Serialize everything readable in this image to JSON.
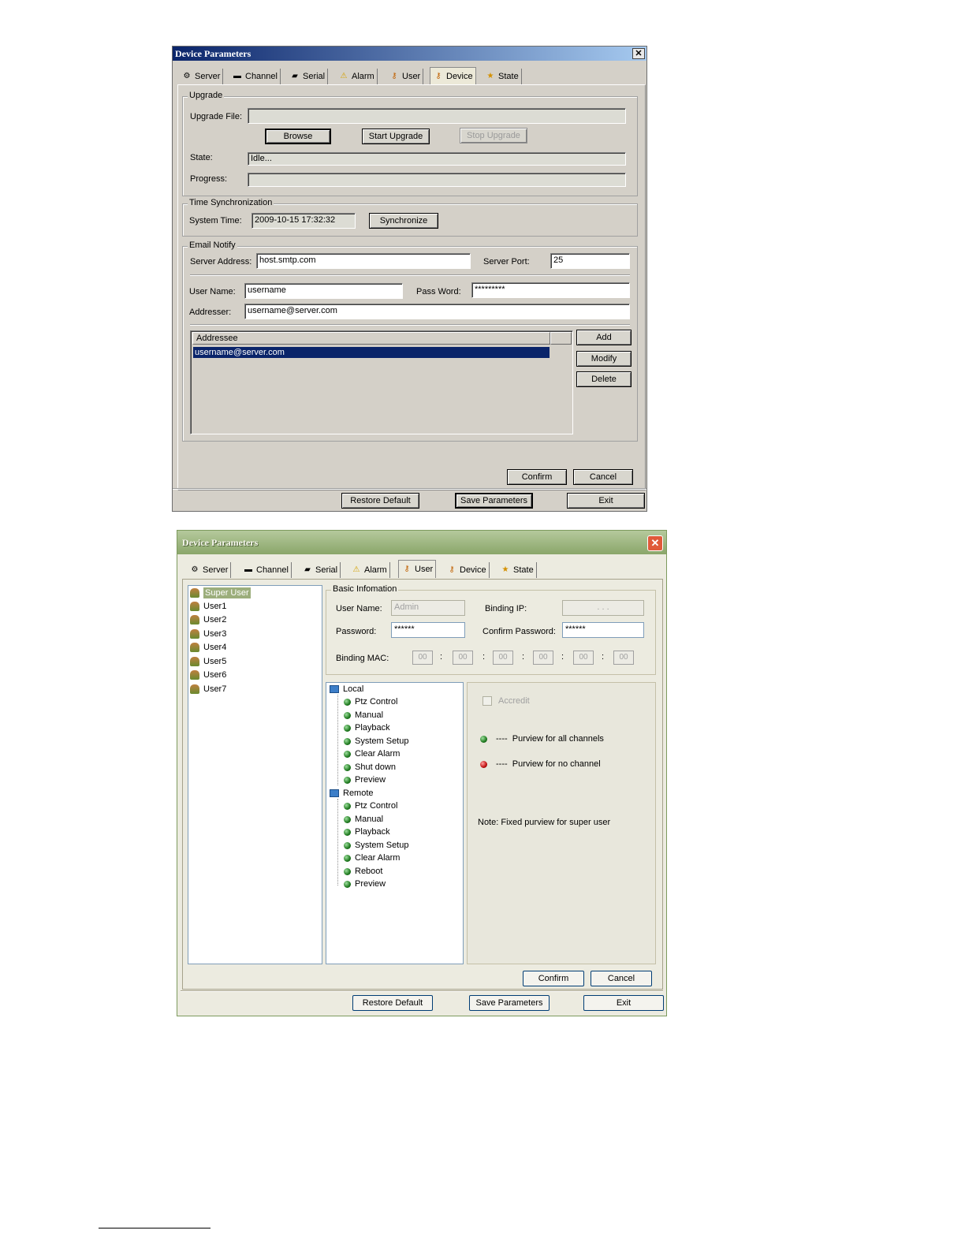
{
  "window1": {
    "title": "Device Parameters",
    "close_glyph": "✕",
    "tabs": [
      {
        "label": "Server",
        "icon": "gear-icon"
      },
      {
        "label": "Channel",
        "icon": "channel-icon"
      },
      {
        "label": "Serial",
        "icon": "serial-icon"
      },
      {
        "label": "Alarm",
        "icon": "warning-icon"
      },
      {
        "label": "User",
        "icon": "key-icon"
      },
      {
        "label": "Device",
        "icon": "key-icon"
      },
      {
        "label": "State",
        "icon": "star-icon"
      }
    ],
    "active_tab": "Device",
    "upgrade": {
      "group_title": "Upgrade",
      "file_label": "Upgrade File:",
      "file_value": "",
      "browse": "Browse",
      "start": "Start Upgrade",
      "stop": "Stop Upgrade",
      "state_label": "State:",
      "state_value": "Idle...",
      "progress_label": "Progress:",
      "progress_value": 0
    },
    "time_sync": {
      "group_title": "Time Synchronization",
      "system_time_label": "System Time:",
      "system_time_value": "2009-10-15 17:32:32",
      "synchronize": "Synchronize"
    },
    "email": {
      "group_title": "Email Notify",
      "server_address_label": "Server Address:",
      "server_address_value": "host.smtp.com",
      "server_port_label": "Server Port:",
      "server_port_value": "25",
      "user_name_label": "User Name:",
      "user_name_value": "username",
      "password_label": "Pass Word:",
      "password_value": "*********",
      "addresser_label": "Addresser:",
      "addresser_value": "username@server.com",
      "list_header": "Addressee",
      "addressees": [
        "username@server.com"
      ],
      "add": "Add",
      "modify": "Modify",
      "delete": "Delete"
    },
    "confirm": "Confirm",
    "cancel": "Cancel",
    "restore_default": "Restore Default",
    "save_parameters": "Save Parameters",
    "exit": "Exit"
  },
  "window2": {
    "title": "Device Parameters",
    "close_glyph": "✕",
    "tabs": [
      {
        "label": "Server",
        "icon": "gear-icon"
      },
      {
        "label": "Channel",
        "icon": "channel-icon"
      },
      {
        "label": "Serial",
        "icon": "serial-icon"
      },
      {
        "label": "Alarm",
        "icon": "warning-icon"
      },
      {
        "label": "User",
        "icon": "key-icon"
      },
      {
        "label": "Device",
        "icon": "key-icon"
      },
      {
        "label": "State",
        "icon": "star-icon"
      }
    ],
    "active_tab": "User",
    "users": [
      "Super User",
      "User1",
      "User2",
      "User3",
      "User4",
      "User5",
      "User6",
      "User7"
    ],
    "selected_user": "Super User",
    "basic": {
      "group_title": "Basic Infomation",
      "user_name_label": "User Name:",
      "user_name_value": "Admin",
      "binding_ip_label": "Binding IP:",
      "binding_ip_value": ". . .",
      "password_label": "Password:",
      "password_value": "******",
      "confirm_password_label": "Confirm Password:",
      "confirm_password_value": "******",
      "binding_mac_label": "Binding MAC:",
      "mac": [
        "00",
        "00",
        "00",
        "00",
        "00",
        "00"
      ],
      "mac_sep": ":"
    },
    "tree": {
      "local_label": "Local",
      "local_items": [
        "Ptz Control",
        "Manual",
        "Playback",
        "System Setup",
        "Clear Alarm",
        "Shut down",
        "Preview"
      ],
      "remote_label": "Remote",
      "remote_items": [
        "Ptz Control",
        "Manual",
        "Playback",
        "System Setup",
        "Clear Alarm",
        "Reboot",
        "Preview"
      ]
    },
    "purview": {
      "accredit_label": "Accredit",
      "all_channels": "----  Purview for all channels",
      "no_channel": "----  Purview for no channel",
      "note": "Note: Fixed purview for super user"
    },
    "confirm": "Confirm",
    "cancel": "Cancel",
    "restore_default": "Restore Default",
    "save_parameters": "Save Parameters",
    "exit": "Exit"
  }
}
